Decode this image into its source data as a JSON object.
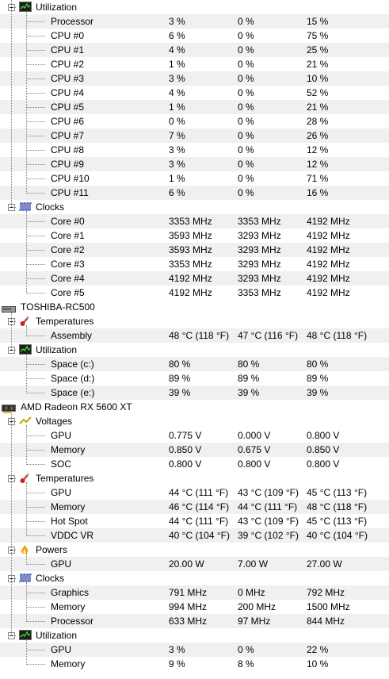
{
  "sections": [
    {
      "type": "sub",
      "label": "Utilization",
      "icon": "utilization-icon",
      "rows": [
        {
          "label": "Processor",
          "v": [
            "3 %",
            "0 %",
            "15 %"
          ]
        },
        {
          "label": "CPU #0",
          "v": [
            "6 %",
            "0 %",
            "75 %"
          ]
        },
        {
          "label": "CPU #1",
          "v": [
            "4 %",
            "0 %",
            "25 %"
          ]
        },
        {
          "label": "CPU #2",
          "v": [
            "1 %",
            "0 %",
            "21 %"
          ]
        },
        {
          "label": "CPU #3",
          "v": [
            "3 %",
            "0 %",
            "10 %"
          ]
        },
        {
          "label": "CPU #4",
          "v": [
            "4 %",
            "0 %",
            "52 %"
          ]
        },
        {
          "label": "CPU #5",
          "v": [
            "1 %",
            "0 %",
            "21 %"
          ]
        },
        {
          "label": "CPU #6",
          "v": [
            "0 %",
            "0 %",
            "28 %"
          ]
        },
        {
          "label": "CPU #7",
          "v": [
            "7 %",
            "0 %",
            "26 %"
          ]
        },
        {
          "label": "CPU #8",
          "v": [
            "3 %",
            "0 %",
            "12 %"
          ]
        },
        {
          "label": "CPU #9",
          "v": [
            "3 %",
            "0 %",
            "12 %"
          ]
        },
        {
          "label": "CPU #10",
          "v": [
            "1 %",
            "0 %",
            "71 %"
          ]
        },
        {
          "label": "CPU #11",
          "v": [
            "6 %",
            "0 %",
            "16 %"
          ]
        }
      ]
    },
    {
      "type": "sub",
      "label": "Clocks",
      "icon": "clock-icon",
      "rows": [
        {
          "label": "Core #0",
          "v": [
            "3353 MHz",
            "3353 MHz",
            "4192 MHz"
          ]
        },
        {
          "label": "Core #1",
          "v": [
            "3593 MHz",
            "3293 MHz",
            "4192 MHz"
          ]
        },
        {
          "label": "Core #2",
          "v": [
            "3593 MHz",
            "3293 MHz",
            "4192 MHz"
          ]
        },
        {
          "label": "Core #3",
          "v": [
            "3353 MHz",
            "3293 MHz",
            "4192 MHz"
          ]
        },
        {
          "label": "Core #4",
          "v": [
            "4192 MHz",
            "3293 MHz",
            "4192 MHz"
          ]
        },
        {
          "label": "Core #5",
          "v": [
            "4192 MHz",
            "3353 MHz",
            "4192 MHz"
          ]
        }
      ]
    },
    {
      "type": "device",
      "label": "TOSHIBA-RC500",
      "icon": "drive-icon"
    },
    {
      "type": "sub",
      "label": "Temperatures",
      "icon": "thermometer-icon",
      "rows": [
        {
          "label": "Assembly",
          "v": [
            "48 °C  (118 °F)",
            "47 °C  (116 °F)",
            "48 °C  (118 °F)"
          ]
        }
      ]
    },
    {
      "type": "sub",
      "label": "Utilization",
      "icon": "utilization-icon",
      "rows": [
        {
          "label": "Space (c:)",
          "v": [
            "80 %",
            "80 %",
            "80 %"
          ]
        },
        {
          "label": "Space (d:)",
          "v": [
            "89 %",
            "89 %",
            "89 %"
          ]
        },
        {
          "label": "Space (e:)",
          "v": [
            "39 %",
            "39 %",
            "39 %"
          ]
        }
      ]
    },
    {
      "type": "device",
      "label": "AMD Radeon RX 5600 XT",
      "icon": "gpu-icon"
    },
    {
      "type": "sub",
      "label": "Voltages",
      "icon": "voltage-icon",
      "rows": [
        {
          "label": "GPU",
          "v": [
            "0.775 V",
            "0.000 V",
            "0.800 V"
          ]
        },
        {
          "label": "Memory",
          "v": [
            "0.850 V",
            "0.675 V",
            "0.850 V"
          ]
        },
        {
          "label": "SOC",
          "v": [
            "0.800 V",
            "0.800 V",
            "0.800 V"
          ]
        }
      ]
    },
    {
      "type": "sub",
      "label": "Temperatures",
      "icon": "thermometer-icon",
      "rows": [
        {
          "label": "GPU",
          "v": [
            "44 °C  (111 °F)",
            "43 °C  (109 °F)",
            "45 °C  (113 °F)"
          ]
        },
        {
          "label": "Memory",
          "v": [
            "46 °C  (114 °F)",
            "44 °C  (111 °F)",
            "48 °C  (118 °F)"
          ]
        },
        {
          "label": "Hot Spot",
          "v": [
            "44 °C  (111 °F)",
            "43 °C  (109 °F)",
            "45 °C  (113 °F)"
          ]
        },
        {
          "label": "VDDC VR",
          "v": [
            "40 °C  (104 °F)",
            "39 °C  (102 °F)",
            "40 °C  (104 °F)"
          ]
        }
      ]
    },
    {
      "type": "sub",
      "label": "Powers",
      "icon": "power-icon",
      "rows": [
        {
          "label": "GPU",
          "v": [
            "20.00 W",
            "7.00 W",
            "27.00 W"
          ]
        }
      ]
    },
    {
      "type": "sub",
      "label": "Clocks",
      "icon": "clock-icon",
      "rows": [
        {
          "label": "Graphics",
          "v": [
            "791 MHz",
            "0 MHz",
            "792 MHz"
          ]
        },
        {
          "label": "Memory",
          "v": [
            "994 MHz",
            "200 MHz",
            "1500 MHz"
          ]
        },
        {
          "label": "Processor",
          "v": [
            "633 MHz",
            "97 MHz",
            "844 MHz"
          ]
        }
      ]
    },
    {
      "type": "sub",
      "label": "Utilization",
      "icon": "utilization-icon",
      "rows": [
        {
          "label": "GPU",
          "v": [
            "3 %",
            "0 %",
            "22 %"
          ]
        },
        {
          "label": "Memory",
          "v": [
            "9 %",
            "8 %",
            "10 %"
          ]
        }
      ]
    }
  ]
}
